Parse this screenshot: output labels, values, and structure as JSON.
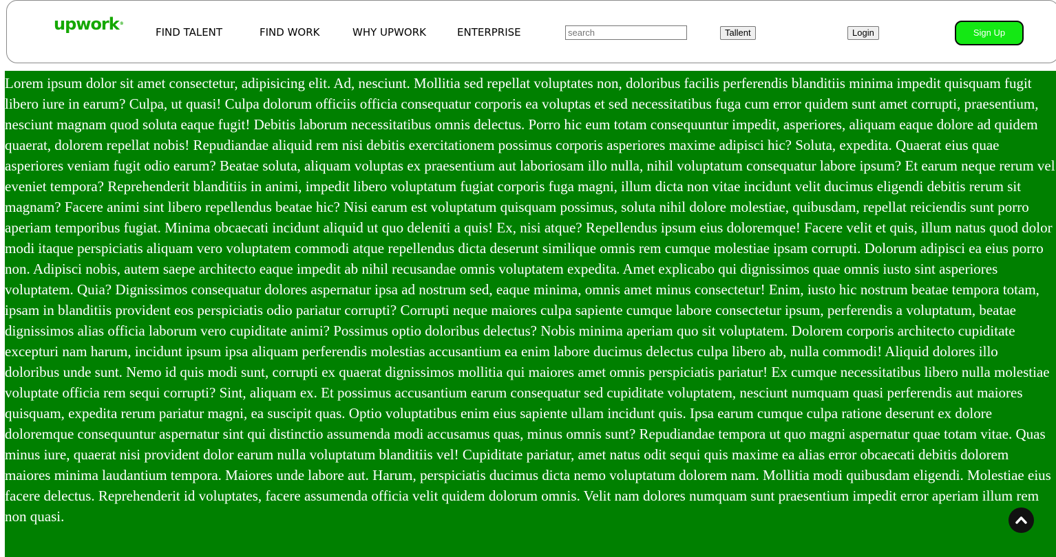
{
  "header": {
    "logo": "upwork",
    "logo_mark": "®",
    "nav": [
      "FIND TALENT",
      "FIND WORK",
      "WHY UPWORK",
      "ENTERPRISE"
    ],
    "search_placeholder": "search",
    "talent_button": "Tallent",
    "login_button": "Login",
    "signup_button": "Sign Up"
  },
  "main": {
    "paragraph": "Lorem ipsum dolor sit amet consectetur, adipisicing elit. Ad, nesciunt. Mollitia sed repellat voluptates non, doloribus facilis perferendis blanditiis minima impedit quisquam fugit libero iure in earum? Culpa, ut quasi! Culpa dolorum officiis officia consequatur corporis ea voluptas et sed necessitatibus fuga cum error quidem sunt amet corrupti, praesentium, nesciunt magnam quod soluta eaque fugit! Debitis laborum necessitatibus omnis delectus. Porro hic eum totam consequuntur impedit, asperiores, aliquam eaque dolore ad quidem quaerat, dolorem repellat nobis! Repudiandae aliquid rem nisi debitis exercitationem possimus corporis asperiores maxime adipisci hic? Soluta, expedita. Quaerat eius quae asperiores veniam fugit odio earum? Beatae soluta, aliquam voluptas ex praesentium aut laboriosam illo nulla, nihil voluptatum consequatur labore ipsum? Et earum neque rerum vel eveniet tempora? Reprehenderit blanditiis in animi, impedit libero voluptatum fugiat corporis fuga magni, illum dicta non vitae incidunt velit ducimus eligendi debitis rerum sit magnam? Facere animi sint libero repellendus beatae hic? Nisi earum est voluptatum quisquam possimus, soluta nihil dolore molestiae, quibusdam, repellat reiciendis sunt porro aperiam temporibus fugiat. Minima obcaecati incidunt aliquid ut quo deleniti a quis! Ex, nisi atque? Repellendus ipsum eius doloremque! Facere velit et quis, illum natus quod dolor modi itaque perspiciatis aliquam vero voluptatem commodi atque repellendus dicta deserunt similique omnis rem cumque molestiae ipsam corrupti. Dolorum adipisci ea eius porro non. Adipisci nobis, autem saepe architecto eaque impedit ab nihil recusandae omnis voluptatem expedita. Amet explicabo qui dignissimos quae omnis iusto sint asperiores voluptatem. Quia? Dignissimos consequatur dolores aspernatur ipsa ad nostrum sed, eaque minima, omnis amet minus consectetur! Enim, iusto hic nostrum beatae tempora totam, ipsam in blanditiis provident eos perspiciatis odio pariatur corrupti? Corrupti neque maiores culpa sapiente cumque labore consectetur ipsum, perferendis a voluptatum, beatae dignissimos alias officia laborum vero cupiditate animi? Possimus optio doloribus delectus? Nobis minima aperiam quo sit voluptatem. Dolorem corporis architecto cupiditate excepturi nam harum, incidunt ipsum ipsa aliquam perferendis molestias accusantium ea enim labore ducimus delectus culpa libero ab, nulla commodi! Aliquid dolores illo doloribus unde sunt. Nemo id quis modi sunt, corrupti ex quaerat dignissimos mollitia qui maiores amet omnis perspiciatis pariatur! Ex cumque necessitatibus libero nulla molestiae voluptate officia rem sequi corrupti? Sint, aliquam ex. Et possimus accusantium earum consequatur sed cupiditate voluptatem, nesciunt numquam quasi perferendis aut maiores quisquam, expedita rerum pariatur magni, ea suscipit quas. Optio voluptatibus enim eius sapiente ullam incidunt quis. Ipsa earum cumque culpa ratione deserunt ex dolore doloremque consequuntur aspernatur sint qui distinctio assumenda modi accusamus quas, minus omnis sunt? Repudiandae tempora ut quo magni aspernatur quae totam vitae. Quas minus iure, quaerat nisi provident dolor earum nulla voluptatum blanditiis vel! Cupiditate pariatur, amet natus odit sequi quis maxime ea alias error obcaecati debitis dolorem maiores minima laudantium tempora. Maiores unde labore aut. Harum, perspiciatis ducimus dicta nemo voluptatum dolorem nam. Mollitia modi quibusdam eligendi. Molestiae eius facere delectus. Reprehenderit id voluptates, facere assumenda officia velit quidem dolorum omnis. Velit nam dolores numquam sunt praesentium impedit error aperiam illum rem non quasi."
  },
  "scroll_top_icon": "chevron-up-icon",
  "colors": {
    "brand": "#14a800",
    "content_background": "#008000",
    "signup_background": "#14e814"
  }
}
